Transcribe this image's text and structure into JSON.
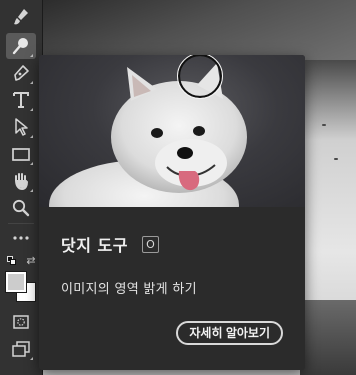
{
  "toolbar": {
    "tools": [
      {
        "name": "brush-tool",
        "icon": "brush-icon"
      },
      {
        "name": "dodge-tool",
        "icon": "dodge-icon",
        "active": true
      },
      {
        "name": "pen-tool",
        "icon": "pen-icon"
      },
      {
        "name": "type-tool",
        "icon": "type-icon",
        "glyph": "T"
      },
      {
        "name": "path-selection-tool",
        "icon": "arrow-icon"
      },
      {
        "name": "rectangle-tool",
        "icon": "rectangle-icon"
      },
      {
        "name": "hand-tool",
        "icon": "hand-icon"
      },
      {
        "name": "zoom-tool",
        "icon": "magnifier-icon"
      },
      {
        "name": "more-tools",
        "icon": "ellipsis-icon",
        "glyph": "•••"
      },
      {
        "name": "quick-mask",
        "icon": "quick-mask-icon"
      },
      {
        "name": "screen-mode",
        "icon": "screen-mode-icon"
      }
    ],
    "swap_glyph": "⇄",
    "foreground_color": "#cccccc",
    "background_color": "#ffffff"
  },
  "tooltip": {
    "title": "닷지 도구",
    "shortcut": "O",
    "description": "이미지의 영역 밝게 하기",
    "learn_more": "자세히 알아보기"
  },
  "colors": {
    "toolbar_bg": "#323232",
    "tooltip_bg": "#2b2b2b",
    "active_tool_bg": "#5a5a5a"
  }
}
